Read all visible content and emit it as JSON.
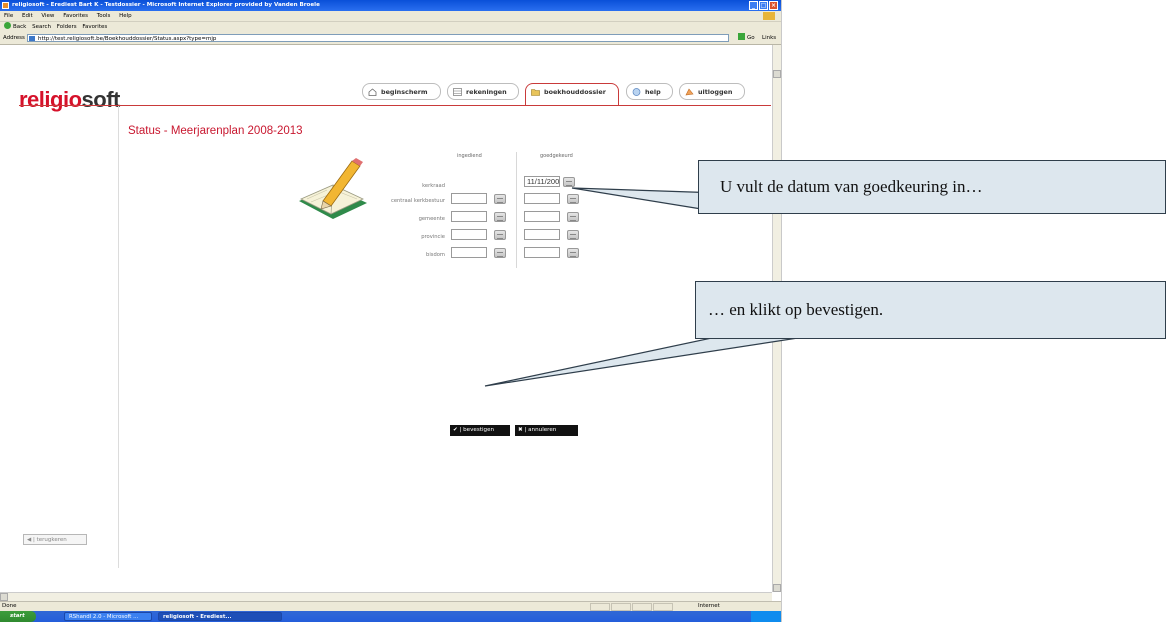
{
  "window": {
    "title": "religiosoft - Erediest Bart K - Testdossier - Microsoft Internet Explorer provided by Vanden Broele",
    "controls": [
      "_",
      "□",
      "×"
    ]
  },
  "menubar": {
    "items": [
      "File",
      "Edit",
      "View",
      "Favorites",
      "Tools",
      "Help"
    ]
  },
  "toolbar": {
    "items": [
      "Back",
      "Search",
      "Folders",
      "Favorites"
    ]
  },
  "addressbar": {
    "label": "Address",
    "url": "http://test.religiosoft.be/Boekhouddossier/Status.aspx?type=mjp",
    "go": "Go",
    "links": "Links"
  },
  "logo": {
    "part1": "religio",
    "part2": "soft"
  },
  "nav": [
    {
      "label": "beginscherm",
      "icon": "home-icon"
    },
    {
      "label": "rekeningen",
      "icon": "table-icon"
    },
    {
      "label": "boekhouddossier",
      "icon": "folder-icon",
      "active": true
    },
    {
      "label": "help",
      "icon": "help-icon"
    },
    {
      "label": "uitloggen",
      "icon": "logout-icon"
    }
  ],
  "page": {
    "title": "Status - Meerjarenplan 2008-2013"
  },
  "form": {
    "col_ingediend": "ingediend",
    "col_goedgekeurd": "goedgekeurd",
    "rows": [
      {
        "label": "kerkraad",
        "ingediend": null,
        "goedgekeurd": "11/11/2007"
      },
      {
        "label": "centraal kerkbestuur",
        "ingediend": "",
        "goedgekeurd": ""
      },
      {
        "label": "gemeente",
        "ingediend": "",
        "goedgekeurd": ""
      },
      {
        "label": "provincie",
        "ingediend": "",
        "goedgekeurd": ""
      },
      {
        "label": "bisdom",
        "ingediend": "",
        "goedgekeurd": ""
      }
    ]
  },
  "buttons": {
    "confirm": "✔ | bevestigen",
    "cancel": "✖ | annuleren",
    "back": "◀ | terugkeren"
  },
  "statusbar": {
    "left": "Done",
    "zone": "Internet"
  },
  "taskbar": {
    "start": "start",
    "tasks": [
      "RShandl 2.0 - Microsoft ...",
      "religiosoft - Erediest..."
    ]
  },
  "callouts": [
    "U vult de datum van goedkeuring in…",
    "… en klikt op bevestigen."
  ],
  "colors": {
    "brand_red": "#c8172f",
    "callout_bg": "#dde7ee",
    "xp_blue": "#0a50d8"
  }
}
